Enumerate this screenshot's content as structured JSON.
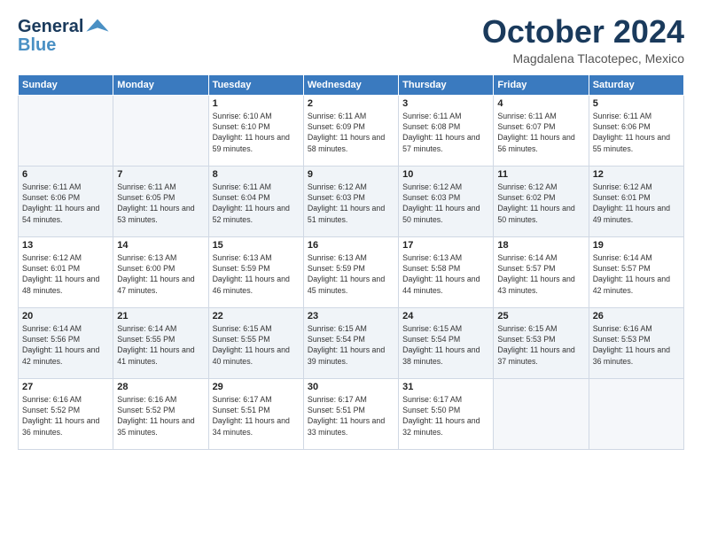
{
  "logo": {
    "line1": "General",
    "line2": "Blue"
  },
  "title": "October 2024",
  "location": "Magdalena Tlacotepec, Mexico",
  "days_of_week": [
    "Sunday",
    "Monday",
    "Tuesday",
    "Wednesday",
    "Thursday",
    "Friday",
    "Saturday"
  ],
  "weeks": [
    [
      {
        "day": "",
        "info": ""
      },
      {
        "day": "",
        "info": ""
      },
      {
        "day": "1",
        "info": "Sunrise: 6:10 AM\nSunset: 6:10 PM\nDaylight: 11 hours and 59 minutes."
      },
      {
        "day": "2",
        "info": "Sunrise: 6:11 AM\nSunset: 6:09 PM\nDaylight: 11 hours and 58 minutes."
      },
      {
        "day": "3",
        "info": "Sunrise: 6:11 AM\nSunset: 6:08 PM\nDaylight: 11 hours and 57 minutes."
      },
      {
        "day": "4",
        "info": "Sunrise: 6:11 AM\nSunset: 6:07 PM\nDaylight: 11 hours and 56 minutes."
      },
      {
        "day": "5",
        "info": "Sunrise: 6:11 AM\nSunset: 6:06 PM\nDaylight: 11 hours and 55 minutes."
      }
    ],
    [
      {
        "day": "6",
        "info": "Sunrise: 6:11 AM\nSunset: 6:06 PM\nDaylight: 11 hours and 54 minutes."
      },
      {
        "day": "7",
        "info": "Sunrise: 6:11 AM\nSunset: 6:05 PM\nDaylight: 11 hours and 53 minutes."
      },
      {
        "day": "8",
        "info": "Sunrise: 6:11 AM\nSunset: 6:04 PM\nDaylight: 11 hours and 52 minutes."
      },
      {
        "day": "9",
        "info": "Sunrise: 6:12 AM\nSunset: 6:03 PM\nDaylight: 11 hours and 51 minutes."
      },
      {
        "day": "10",
        "info": "Sunrise: 6:12 AM\nSunset: 6:03 PM\nDaylight: 11 hours and 50 minutes."
      },
      {
        "day": "11",
        "info": "Sunrise: 6:12 AM\nSunset: 6:02 PM\nDaylight: 11 hours and 50 minutes."
      },
      {
        "day": "12",
        "info": "Sunrise: 6:12 AM\nSunset: 6:01 PM\nDaylight: 11 hours and 49 minutes."
      }
    ],
    [
      {
        "day": "13",
        "info": "Sunrise: 6:12 AM\nSunset: 6:01 PM\nDaylight: 11 hours and 48 minutes."
      },
      {
        "day": "14",
        "info": "Sunrise: 6:13 AM\nSunset: 6:00 PM\nDaylight: 11 hours and 47 minutes."
      },
      {
        "day": "15",
        "info": "Sunrise: 6:13 AM\nSunset: 5:59 PM\nDaylight: 11 hours and 46 minutes."
      },
      {
        "day": "16",
        "info": "Sunrise: 6:13 AM\nSunset: 5:59 PM\nDaylight: 11 hours and 45 minutes."
      },
      {
        "day": "17",
        "info": "Sunrise: 6:13 AM\nSunset: 5:58 PM\nDaylight: 11 hours and 44 minutes."
      },
      {
        "day": "18",
        "info": "Sunrise: 6:14 AM\nSunset: 5:57 PM\nDaylight: 11 hours and 43 minutes."
      },
      {
        "day": "19",
        "info": "Sunrise: 6:14 AM\nSunset: 5:57 PM\nDaylight: 11 hours and 42 minutes."
      }
    ],
    [
      {
        "day": "20",
        "info": "Sunrise: 6:14 AM\nSunset: 5:56 PM\nDaylight: 11 hours and 42 minutes."
      },
      {
        "day": "21",
        "info": "Sunrise: 6:14 AM\nSunset: 5:55 PM\nDaylight: 11 hours and 41 minutes."
      },
      {
        "day": "22",
        "info": "Sunrise: 6:15 AM\nSunset: 5:55 PM\nDaylight: 11 hours and 40 minutes."
      },
      {
        "day": "23",
        "info": "Sunrise: 6:15 AM\nSunset: 5:54 PM\nDaylight: 11 hours and 39 minutes."
      },
      {
        "day": "24",
        "info": "Sunrise: 6:15 AM\nSunset: 5:54 PM\nDaylight: 11 hours and 38 minutes."
      },
      {
        "day": "25",
        "info": "Sunrise: 6:15 AM\nSunset: 5:53 PM\nDaylight: 11 hours and 37 minutes."
      },
      {
        "day": "26",
        "info": "Sunrise: 6:16 AM\nSunset: 5:53 PM\nDaylight: 11 hours and 36 minutes."
      }
    ],
    [
      {
        "day": "27",
        "info": "Sunrise: 6:16 AM\nSunset: 5:52 PM\nDaylight: 11 hours and 36 minutes."
      },
      {
        "day": "28",
        "info": "Sunrise: 6:16 AM\nSunset: 5:52 PM\nDaylight: 11 hours and 35 minutes."
      },
      {
        "day": "29",
        "info": "Sunrise: 6:17 AM\nSunset: 5:51 PM\nDaylight: 11 hours and 34 minutes."
      },
      {
        "day": "30",
        "info": "Sunrise: 6:17 AM\nSunset: 5:51 PM\nDaylight: 11 hours and 33 minutes."
      },
      {
        "day": "31",
        "info": "Sunrise: 6:17 AM\nSunset: 5:50 PM\nDaylight: 11 hours and 32 minutes."
      },
      {
        "day": "",
        "info": ""
      },
      {
        "day": "",
        "info": ""
      }
    ]
  ]
}
